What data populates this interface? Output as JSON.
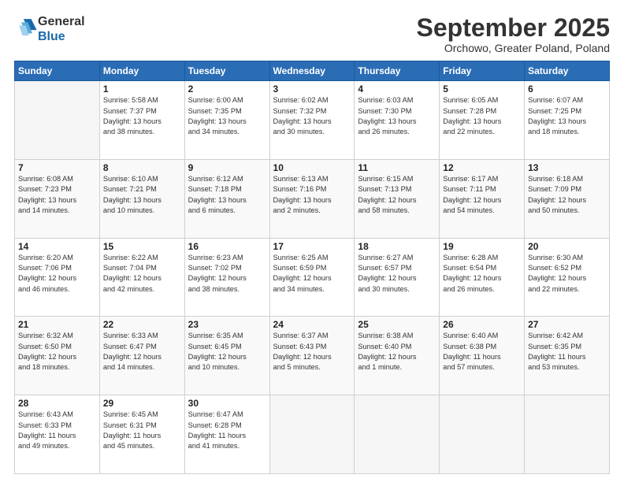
{
  "header": {
    "logo_general": "General",
    "logo_blue": "Blue",
    "month_title": "September 2025",
    "location": "Orchowo, Greater Poland, Poland"
  },
  "calendar": {
    "weekdays": [
      "Sunday",
      "Monday",
      "Tuesday",
      "Wednesday",
      "Thursday",
      "Friday",
      "Saturday"
    ],
    "weeks": [
      [
        {
          "day": "",
          "info": ""
        },
        {
          "day": "1",
          "info": "Sunrise: 5:58 AM\nSunset: 7:37 PM\nDaylight: 13 hours\nand 38 minutes."
        },
        {
          "day": "2",
          "info": "Sunrise: 6:00 AM\nSunset: 7:35 PM\nDaylight: 13 hours\nand 34 minutes."
        },
        {
          "day": "3",
          "info": "Sunrise: 6:02 AM\nSunset: 7:32 PM\nDaylight: 13 hours\nand 30 minutes."
        },
        {
          "day": "4",
          "info": "Sunrise: 6:03 AM\nSunset: 7:30 PM\nDaylight: 13 hours\nand 26 minutes."
        },
        {
          "day": "5",
          "info": "Sunrise: 6:05 AM\nSunset: 7:28 PM\nDaylight: 13 hours\nand 22 minutes."
        },
        {
          "day": "6",
          "info": "Sunrise: 6:07 AM\nSunset: 7:25 PM\nDaylight: 13 hours\nand 18 minutes."
        }
      ],
      [
        {
          "day": "7",
          "info": "Sunrise: 6:08 AM\nSunset: 7:23 PM\nDaylight: 13 hours\nand 14 minutes."
        },
        {
          "day": "8",
          "info": "Sunrise: 6:10 AM\nSunset: 7:21 PM\nDaylight: 13 hours\nand 10 minutes."
        },
        {
          "day": "9",
          "info": "Sunrise: 6:12 AM\nSunset: 7:18 PM\nDaylight: 13 hours\nand 6 minutes."
        },
        {
          "day": "10",
          "info": "Sunrise: 6:13 AM\nSunset: 7:16 PM\nDaylight: 13 hours\nand 2 minutes."
        },
        {
          "day": "11",
          "info": "Sunrise: 6:15 AM\nSunset: 7:13 PM\nDaylight: 12 hours\nand 58 minutes."
        },
        {
          "day": "12",
          "info": "Sunrise: 6:17 AM\nSunset: 7:11 PM\nDaylight: 12 hours\nand 54 minutes."
        },
        {
          "day": "13",
          "info": "Sunrise: 6:18 AM\nSunset: 7:09 PM\nDaylight: 12 hours\nand 50 minutes."
        }
      ],
      [
        {
          "day": "14",
          "info": "Sunrise: 6:20 AM\nSunset: 7:06 PM\nDaylight: 12 hours\nand 46 minutes."
        },
        {
          "day": "15",
          "info": "Sunrise: 6:22 AM\nSunset: 7:04 PM\nDaylight: 12 hours\nand 42 minutes."
        },
        {
          "day": "16",
          "info": "Sunrise: 6:23 AM\nSunset: 7:02 PM\nDaylight: 12 hours\nand 38 minutes."
        },
        {
          "day": "17",
          "info": "Sunrise: 6:25 AM\nSunset: 6:59 PM\nDaylight: 12 hours\nand 34 minutes."
        },
        {
          "day": "18",
          "info": "Sunrise: 6:27 AM\nSunset: 6:57 PM\nDaylight: 12 hours\nand 30 minutes."
        },
        {
          "day": "19",
          "info": "Sunrise: 6:28 AM\nSunset: 6:54 PM\nDaylight: 12 hours\nand 26 minutes."
        },
        {
          "day": "20",
          "info": "Sunrise: 6:30 AM\nSunset: 6:52 PM\nDaylight: 12 hours\nand 22 minutes."
        }
      ],
      [
        {
          "day": "21",
          "info": "Sunrise: 6:32 AM\nSunset: 6:50 PM\nDaylight: 12 hours\nand 18 minutes."
        },
        {
          "day": "22",
          "info": "Sunrise: 6:33 AM\nSunset: 6:47 PM\nDaylight: 12 hours\nand 14 minutes."
        },
        {
          "day": "23",
          "info": "Sunrise: 6:35 AM\nSunset: 6:45 PM\nDaylight: 12 hours\nand 10 minutes."
        },
        {
          "day": "24",
          "info": "Sunrise: 6:37 AM\nSunset: 6:43 PM\nDaylight: 12 hours\nand 5 minutes."
        },
        {
          "day": "25",
          "info": "Sunrise: 6:38 AM\nSunset: 6:40 PM\nDaylight: 12 hours\nand 1 minute."
        },
        {
          "day": "26",
          "info": "Sunrise: 6:40 AM\nSunset: 6:38 PM\nDaylight: 11 hours\nand 57 minutes."
        },
        {
          "day": "27",
          "info": "Sunrise: 6:42 AM\nSunset: 6:35 PM\nDaylight: 11 hours\nand 53 minutes."
        }
      ],
      [
        {
          "day": "28",
          "info": "Sunrise: 6:43 AM\nSunset: 6:33 PM\nDaylight: 11 hours\nand 49 minutes."
        },
        {
          "day": "29",
          "info": "Sunrise: 6:45 AM\nSunset: 6:31 PM\nDaylight: 11 hours\nand 45 minutes."
        },
        {
          "day": "30",
          "info": "Sunrise: 6:47 AM\nSunset: 6:28 PM\nDaylight: 11 hours\nand 41 minutes."
        },
        {
          "day": "",
          "info": ""
        },
        {
          "day": "",
          "info": ""
        },
        {
          "day": "",
          "info": ""
        },
        {
          "day": "",
          "info": ""
        }
      ]
    ]
  }
}
